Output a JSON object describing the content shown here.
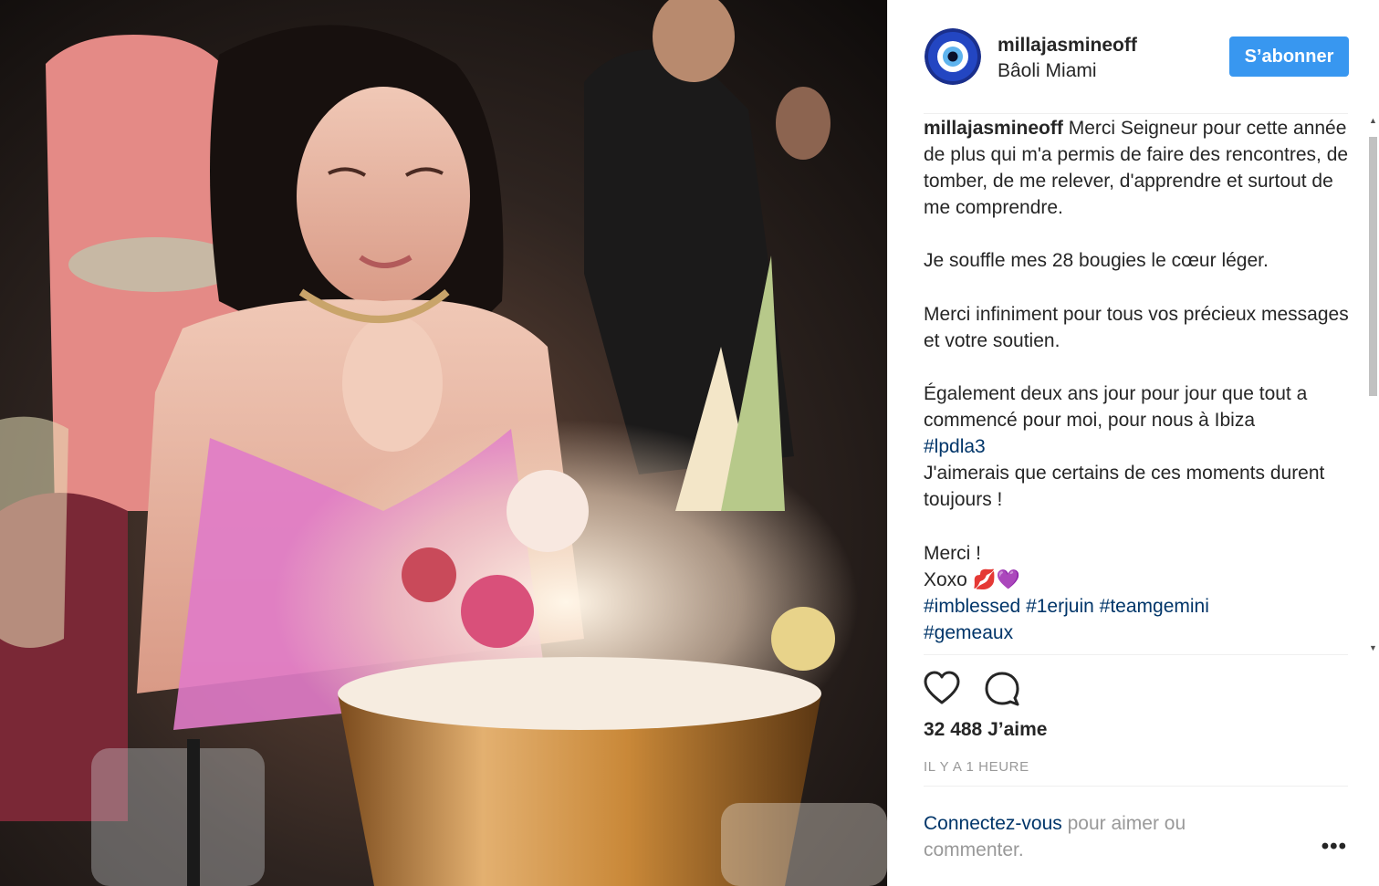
{
  "header": {
    "username": "millajasmineoff",
    "location": "Bâoli Miami",
    "follow_label": "S’abonner"
  },
  "caption": {
    "username": "millajasmineoff",
    "line1": "Merci Seigneur pour cette année de plus qui m'a permis de faire des rencontres, de tomber, de me relever, d'apprendre et surtout de me comprendre.",
    "line2": "Je souffle mes 28 bougies le cœur léger.",
    "line3": "Merci infiniment pour tous vos précieux messages et votre soutien.",
    "line4": "Également deux ans jour pour jour que tout a commencé pour moi, pour nous à Ibiza",
    "tag_lpdla3": "#lpdla3",
    "line5": "J'aimerais que certains de ces moments durent toujours !",
    "line6": "Merci !",
    "line7": "Xoxo 💋💜",
    "tag_imblessed": "#imblessed",
    "tag_1erjuin": "#1erjuin",
    "tag_teamgemini": "#teamgemini",
    "tag_gemeaux": "#gemeaux"
  },
  "actions": {
    "like_icon": "heart-icon",
    "comment_icon": "comment-icon"
  },
  "likes": "32 488 J’aime",
  "time": "IL Y A 1 HEURE",
  "login": {
    "link": "Connectez-vous",
    "rest": " pour aimer ou commenter."
  },
  "more": "•••",
  "colors": {
    "follow": "#3897f0",
    "link": "#003569",
    "text": "#262626",
    "muted": "#999999"
  }
}
